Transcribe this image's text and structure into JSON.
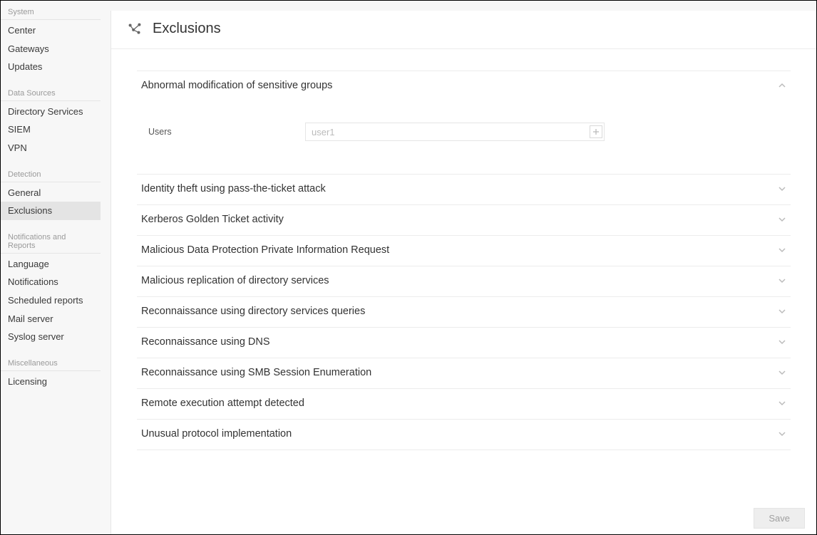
{
  "sidebar": {
    "sections": [
      {
        "header": "System",
        "items": [
          "Center",
          "Gateways",
          "Updates"
        ]
      },
      {
        "header": "Data Sources",
        "items": [
          "Directory Services",
          "SIEM",
          "VPN"
        ]
      },
      {
        "header": "Detection",
        "items": [
          "General",
          "Exclusions"
        ],
        "activeIndex": 1
      },
      {
        "header": "Notifications and Reports",
        "items": [
          "Language",
          "Notifications",
          "Scheduled reports",
          "Mail server",
          "Syslog server"
        ]
      },
      {
        "header": "Miscellaneous",
        "items": [
          "Licensing"
        ]
      }
    ]
  },
  "page": {
    "title": "Exclusions",
    "icon": "network-nodes-icon"
  },
  "panels": [
    {
      "title": "Abnormal modification of sensitive groups",
      "expanded": true,
      "field": {
        "label": "Users",
        "placeholder": "user1",
        "value": ""
      }
    },
    {
      "title": "Identity theft using pass-the-ticket attack",
      "expanded": false
    },
    {
      "title": "Kerberos Golden Ticket activity",
      "expanded": false
    },
    {
      "title": "Malicious Data Protection Private Information Request",
      "expanded": false
    },
    {
      "title": "Malicious replication of directory services",
      "expanded": false
    },
    {
      "title": "Reconnaissance using directory services queries",
      "expanded": false
    },
    {
      "title": "Reconnaissance using DNS",
      "expanded": false
    },
    {
      "title": "Reconnaissance using SMB Session Enumeration",
      "expanded": false
    },
    {
      "title": "Remote execution attempt detected",
      "expanded": false
    },
    {
      "title": "Unusual protocol implementation",
      "expanded": false
    }
  ],
  "actions": {
    "save_label": "Save"
  }
}
